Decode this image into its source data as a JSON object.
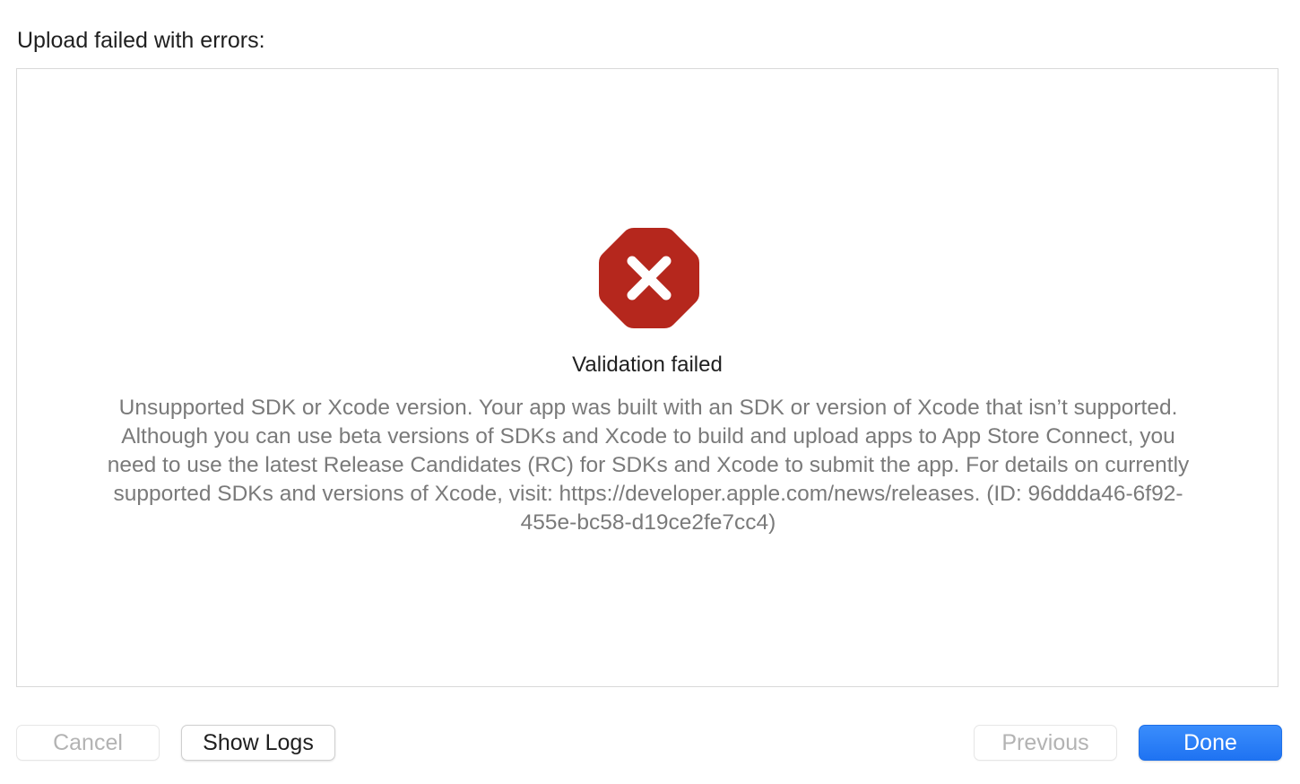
{
  "dialog": {
    "title": "Upload failed with errors:"
  },
  "error": {
    "icon": "error-octagon-icon",
    "icon_color": "#B5271D",
    "heading": "Validation failed",
    "message": "Unsupported SDK or Xcode version. Your app was built with an SDK or version of Xcode that isn’t supported. Although you can use beta versions of SDKs and Xcode to build and upload apps to App Store Connect, you need to use the latest Release Candidates (RC) for SDKs and Xcode to submit the app. For details on currently supported SDKs and versions of Xcode, visit: https://developer.apple.com/news/releases. (ID: 96ddda46-6f92-455e-bc58-d19ce2fe7cc4)"
  },
  "footer": {
    "cancel_label": "Cancel",
    "show_logs_label": "Show Logs",
    "previous_label": "Previous",
    "done_label": "Done",
    "accent_color": "#2A7FF5"
  }
}
